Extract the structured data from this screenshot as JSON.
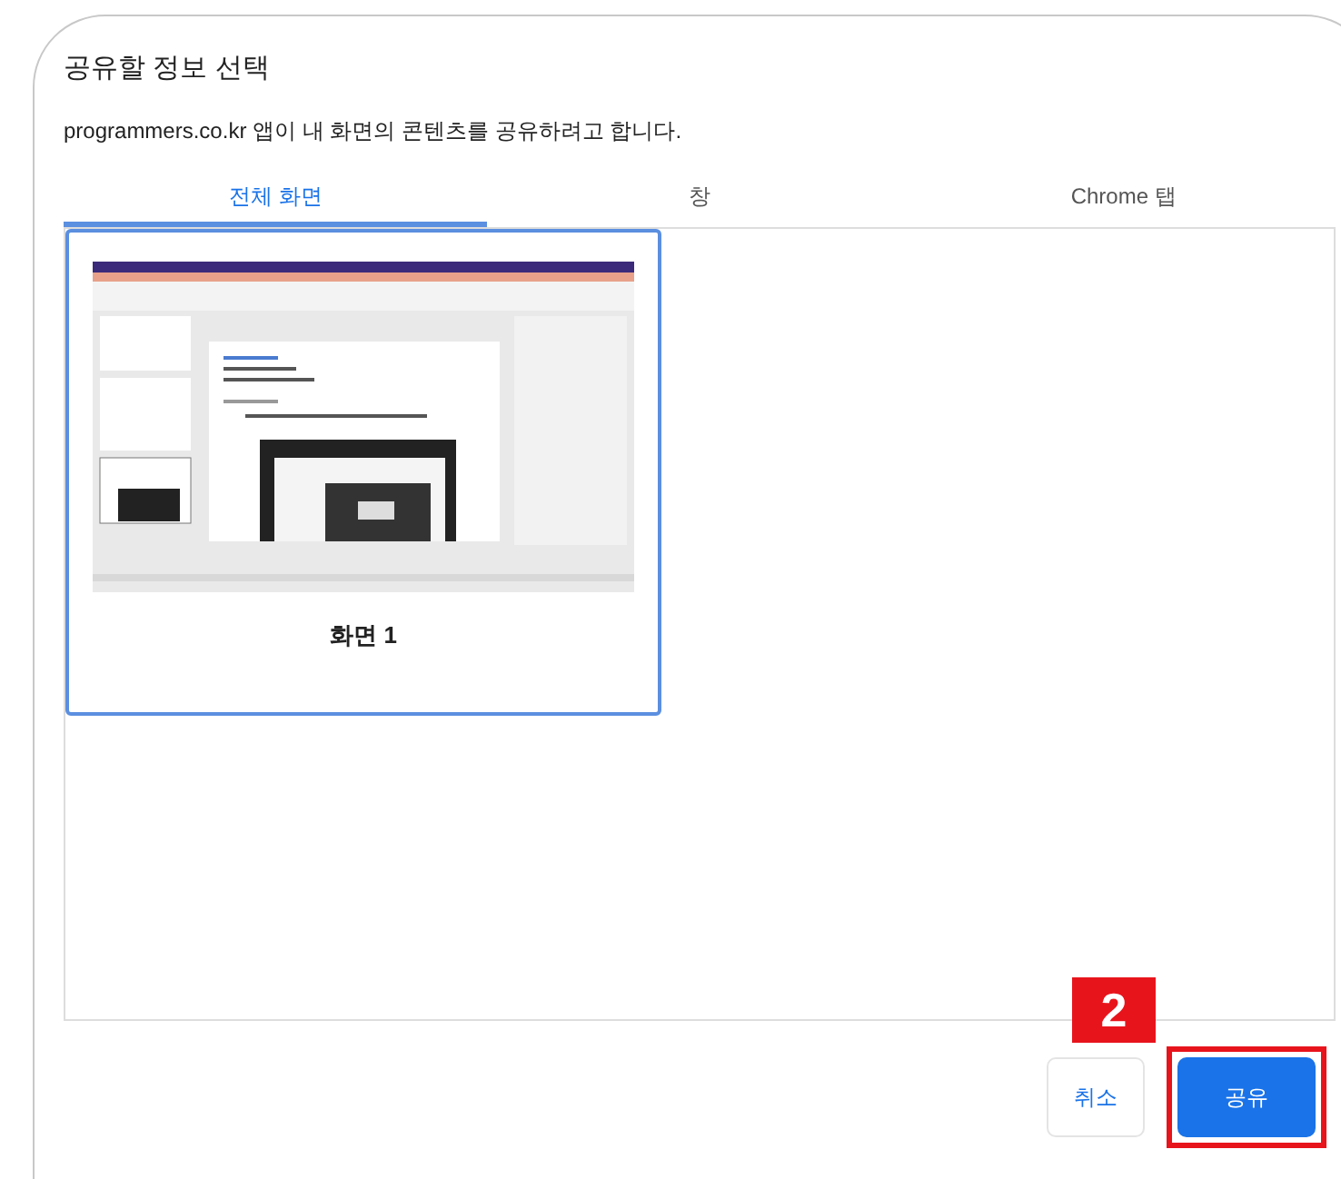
{
  "dialog": {
    "title": "공유할 정보 선택",
    "message": "programmers.co.kr 앱이 내 화면의 콘텐츠를 공유하려고 합니다."
  },
  "tabs": [
    {
      "label": "전체 화면",
      "selected": true
    },
    {
      "label": "창",
      "selected": false
    },
    {
      "label": "Chrome 탭",
      "selected": false
    }
  ],
  "screens": [
    {
      "label": "화면 1",
      "selected": true
    }
  ],
  "step_badge": "2",
  "buttons": [
    {
      "label": "취소",
      "kind": "secondary",
      "highlighted": false
    },
    {
      "label": "공유",
      "kind": "primary",
      "highlighted": true
    }
  ]
}
